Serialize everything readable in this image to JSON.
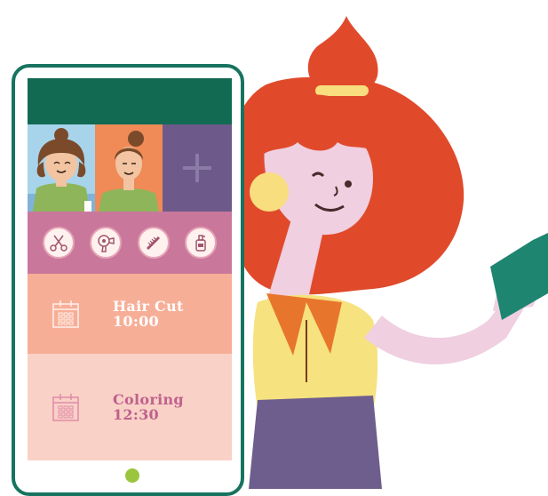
{
  "colors": {
    "phone_frame": "#167360",
    "topbar": "#126A53",
    "add_tile": "#6D5A8A",
    "services_bar": "#C9789C",
    "appointment_1_bg": "#F7AE97",
    "appointment_2_bg": "#F9D1C6",
    "home_button": "#9BC53D"
  },
  "stylists": [
    {
      "icon": "stylist-woman-avatar"
    },
    {
      "icon": "stylist-man-avatar"
    }
  ],
  "add_stylist": {
    "icon": "plus-icon"
  },
  "services": [
    {
      "icon": "scissors-icon"
    },
    {
      "icon": "hair-dryer-icon"
    },
    {
      "icon": "comb-icon"
    },
    {
      "icon": "shampoo-bottle-icon"
    }
  ],
  "appointments": [
    {
      "title": "Hair Cut",
      "time": "10:00",
      "icon": "calendar-icon"
    },
    {
      "title": "Coloring",
      "time": "12:30",
      "icon": "calendar-icon"
    }
  ]
}
